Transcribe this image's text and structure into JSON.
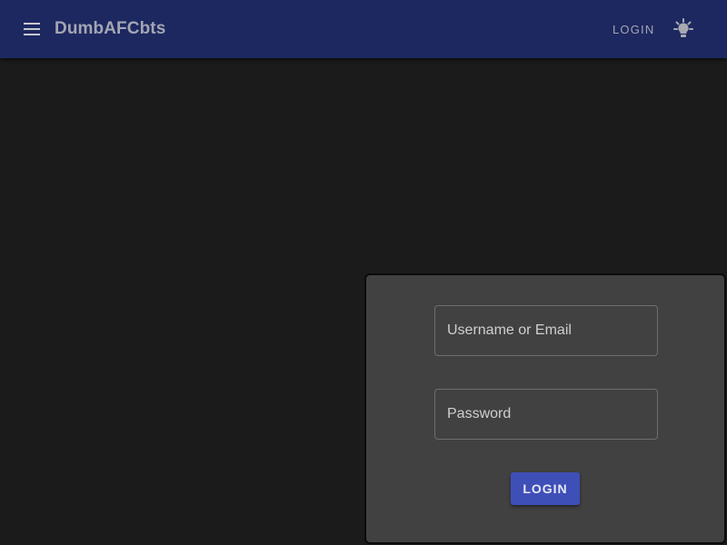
{
  "header": {
    "menu_icon": "menu-icon",
    "title": "DumbAFCbts",
    "login_label": "LOGIN",
    "theme_icon": "lightbulb-icon",
    "background_color": "#1d2860"
  },
  "login_form": {
    "username": {
      "placeholder": "Username or Email",
      "value": ""
    },
    "password": {
      "placeholder": "Password",
      "value": ""
    },
    "submit_label": "LOGIN",
    "button_color": "#3f4fb8"
  }
}
